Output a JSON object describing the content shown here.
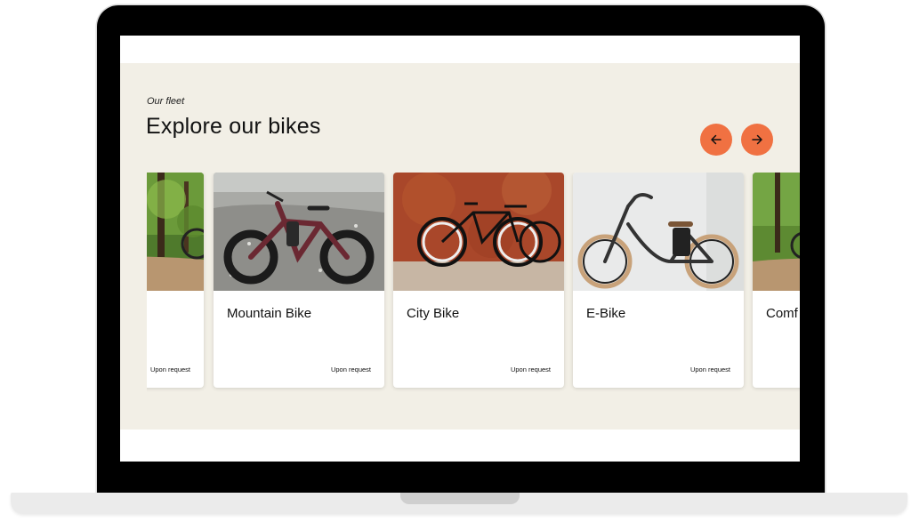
{
  "section": {
    "eyebrow": "Our fleet",
    "title": "Explore our bikes"
  },
  "carousel": {
    "prev_icon": "arrow-left-icon",
    "next_icon": "arrow-right-icon",
    "accent_color": "#f07142",
    "cards": [
      {
        "name": "",
        "price": "Upon request",
        "image": "forest-trail-bike-photo"
      },
      {
        "name": "Mountain Bike",
        "price": "Upon request",
        "image": "fat-tire-mountain-bike-photo"
      },
      {
        "name": "City Bike",
        "price": "Upon request",
        "image": "city-bikes-on-orange-wall-photo"
      },
      {
        "name": "E-Bike",
        "price": "Upon request",
        "image": "cruiser-e-bike-photo"
      },
      {
        "name": "Comf",
        "price": "",
        "image": "forest-trail-bike-photo"
      }
    ]
  },
  "colors": {
    "section_bg": "#f2efe6",
    "card_bg": "#ffffff",
    "laptop_frame": "#000000"
  }
}
